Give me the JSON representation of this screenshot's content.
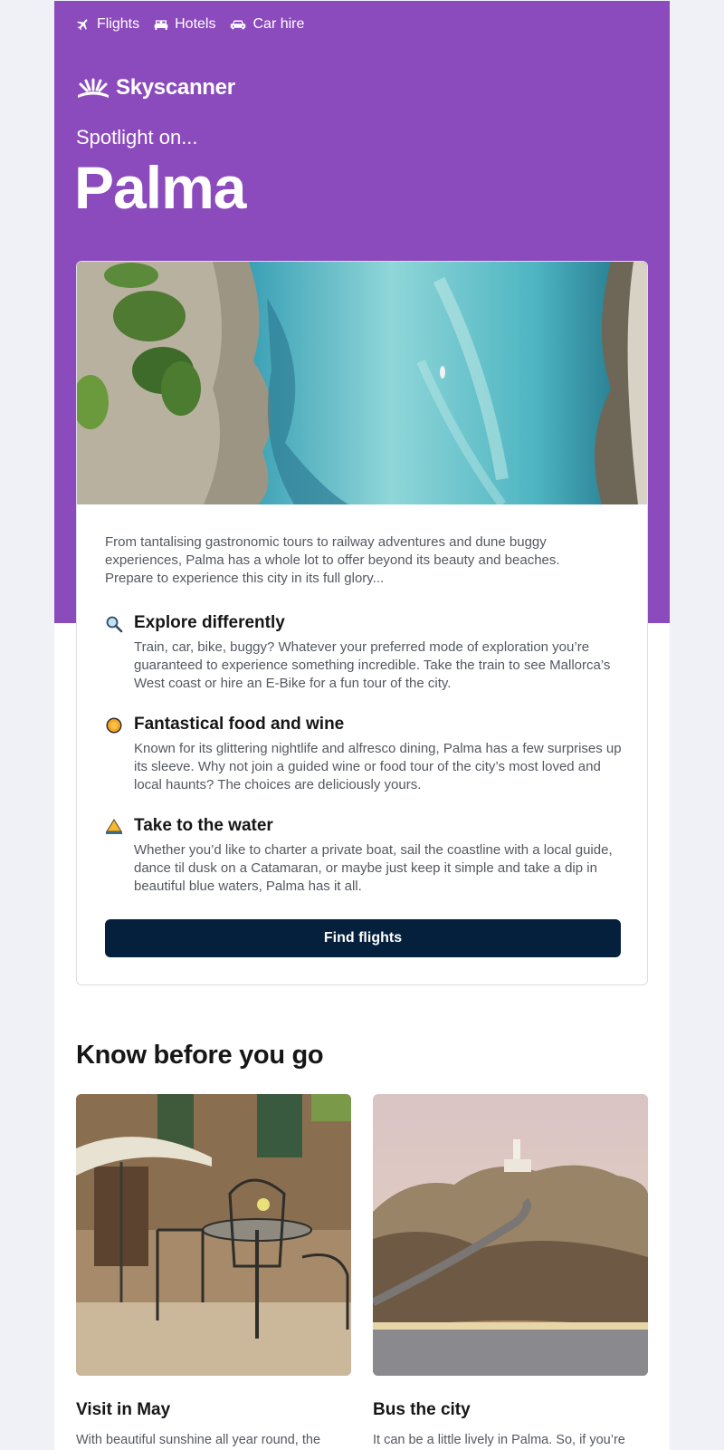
{
  "nav": [
    {
      "label": "Flights",
      "icon": "plane-icon"
    },
    {
      "label": "Hotels",
      "icon": "bed-icon"
    },
    {
      "label": "Car hire",
      "icon": "car-icon"
    }
  ],
  "brand": {
    "name": "Skyscanner",
    "color": "#8b4bbd",
    "cta_color": "#05203c"
  },
  "hero": {
    "kicker": "Spotlight on...",
    "city": "Palma"
  },
  "intro": "From tantalising gastronomic tours to railway adventures and dune buggy experiences, Palma has a whole lot to offer beyond its beauty and beaches. Prepare to experience this city in its full glory...",
  "features": [
    {
      "icon": "magnifying-glass-icon",
      "title": "Explore differently",
      "text": "Train, car, bike, buggy? Whatever your preferred mode of exploration you’re guaranteed to experience something incredible. Take the train to see Mallorca’s West coast or hire an E-Bike for a fun tour of the city."
    },
    {
      "icon": "orange-fruit-icon",
      "title": "Fantastical food and wine",
      "text": "Known for its glittering nightlife and alfresco dining, Palma has a few surprises up its sleeve. Why not join a guided wine or food tour of the city’s most loved and local haunts? The choices are deliciously yours."
    },
    {
      "icon": "sailboat-icon",
      "title": "Take to the water",
      "text": "Whether you’d like to charter a private boat, sail the coastline with a local guide, dance til dusk on a Catamaran, or maybe just keep it simple and take a dip in beautiful blue waters, Palma has it all."
    }
  ],
  "cta": {
    "label": "Find flights"
  },
  "know": {
    "title": "Know before you go",
    "tips": [
      {
        "title": "Visit in May",
        "text": "With beautiful sunshine all year round, the"
      },
      {
        "title": "Bus the city",
        "text": "It can be a little lively in Palma. So, if you’re"
      }
    ]
  }
}
